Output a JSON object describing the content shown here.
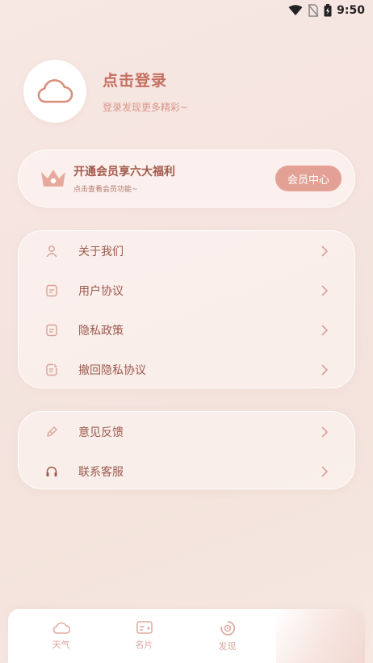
{
  "status_bar": {
    "time": "9:50",
    "icons": [
      "wifi-icon",
      "no-sim-icon",
      "battery-icon"
    ]
  },
  "profile": {
    "avatar_icon": "cloud-icon",
    "title": "点击登录",
    "subtitle": "登录发现更多精彩~"
  },
  "vip": {
    "icon": "crown-icon",
    "title": "开通会员享六大福利",
    "subtitle": "点击查看会员功能~",
    "button_label": "会员中心"
  },
  "menu_group_1": {
    "items": [
      {
        "label": "关于我们",
        "icon": "user-icon"
      },
      {
        "label": "用户协议",
        "icon": "document-icon"
      },
      {
        "label": "隐私政策",
        "icon": "document-icon"
      },
      {
        "label": "撤回隐私协议",
        "icon": "revoke-document-icon"
      }
    ]
  },
  "menu_group_2": {
    "items": [
      {
        "label": "意见反馈",
        "icon": "pencil-icon"
      },
      {
        "label": "联系客服",
        "icon": "headset-icon"
      }
    ]
  },
  "bottom_nav": {
    "items": [
      {
        "label": "天气",
        "icon": "cloud-icon"
      },
      {
        "label": "名片",
        "icon": "card-icon"
      },
      {
        "label": "发现",
        "icon": "discover-icon"
      }
    ]
  },
  "colors": {
    "accent": "#e3a196",
    "title_text": "#c46f5f",
    "menu_text": "#9c5a4e",
    "nav_text": "#dca89f"
  }
}
